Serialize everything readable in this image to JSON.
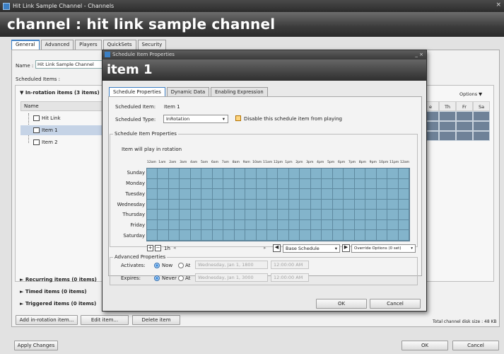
{
  "window": {
    "title": "Hit Link Sample Channel - Channels",
    "close": "×"
  },
  "header": {
    "title": "channel : hit link sample channel"
  },
  "tabs": [
    "General",
    "Advanced",
    "Players",
    "QuickSets",
    "Security"
  ],
  "general": {
    "name_label": "Name :",
    "name_value": "Hit Link Sample Channel",
    "scheduled_items_label": "Scheduled Items :",
    "groups": {
      "in_rotation": "In-rotation items (3 items)",
      "recurring": "Recurring items (0 items)",
      "timed": "Timed items (0 items)",
      "triggered": "Triggered items (0 items)"
    },
    "tree_header": "Name",
    "tree_items": [
      "Hit Link",
      "Item 1",
      "Item 2"
    ],
    "options_label": "Options ▼",
    "week_header": [
      "e",
      "Th",
      "Fr",
      "Sa"
    ],
    "buttons": {
      "add": "Add in-rotation item...",
      "edit": "Edit item...",
      "delete": "Delete item"
    },
    "disk_size": "Total channel disk size : 48 KB"
  },
  "footer": {
    "apply": "Apply Changes",
    "ok": "OK",
    "cancel": "Cancel"
  },
  "dialog": {
    "title": "Schedule Item Properties",
    "close": "_ ×",
    "header": "item 1",
    "tabs": [
      "Schedule Properties",
      "Dynamic Data",
      "Enabling Expression"
    ],
    "scheduled_item_label": "Scheduled Item:",
    "scheduled_item_value": "Item 1",
    "scheduled_type_label": "Scheduled Type:",
    "scheduled_type_value": "InRotation",
    "disable_label": "Disable this schedule item from playing",
    "props_legend": "Schedule Item Properties",
    "rotation_text": "Item will play in rotation",
    "hours": [
      "12am",
      "1am",
      "2am",
      "3am",
      "4am",
      "5am",
      "6am",
      "7am",
      "8am",
      "9am",
      "10am",
      "11am",
      "12pm",
      "1pm",
      "2pm",
      "3pm",
      "4pm",
      "5pm",
      "6pm",
      "7pm",
      "8pm",
      "9pm",
      "10pm",
      "11pm",
      "12am"
    ],
    "days": [
      "Sunday",
      "Monday",
      "Tuesday",
      "Wednesday",
      "Thursday",
      "Friday",
      "Saturday"
    ],
    "zoom_label": "1h",
    "base_schedule": "Base Schedule",
    "override_options": "Override Options (0 set)",
    "advanced_legend": "Advanced Properties",
    "activates_label": "Activates:",
    "expires_label": "Expires:",
    "now_label": "Now",
    "never_label": "Never",
    "at_label": "At",
    "activates_date": "Wednesday, Jan 1, 1800",
    "activates_time": "12:00:00 AM",
    "expires_date": "Wednesday, Jan 1, 3000",
    "expires_time": "12:00:00 AM",
    "ok": "OK",
    "cancel": "Cancel"
  }
}
